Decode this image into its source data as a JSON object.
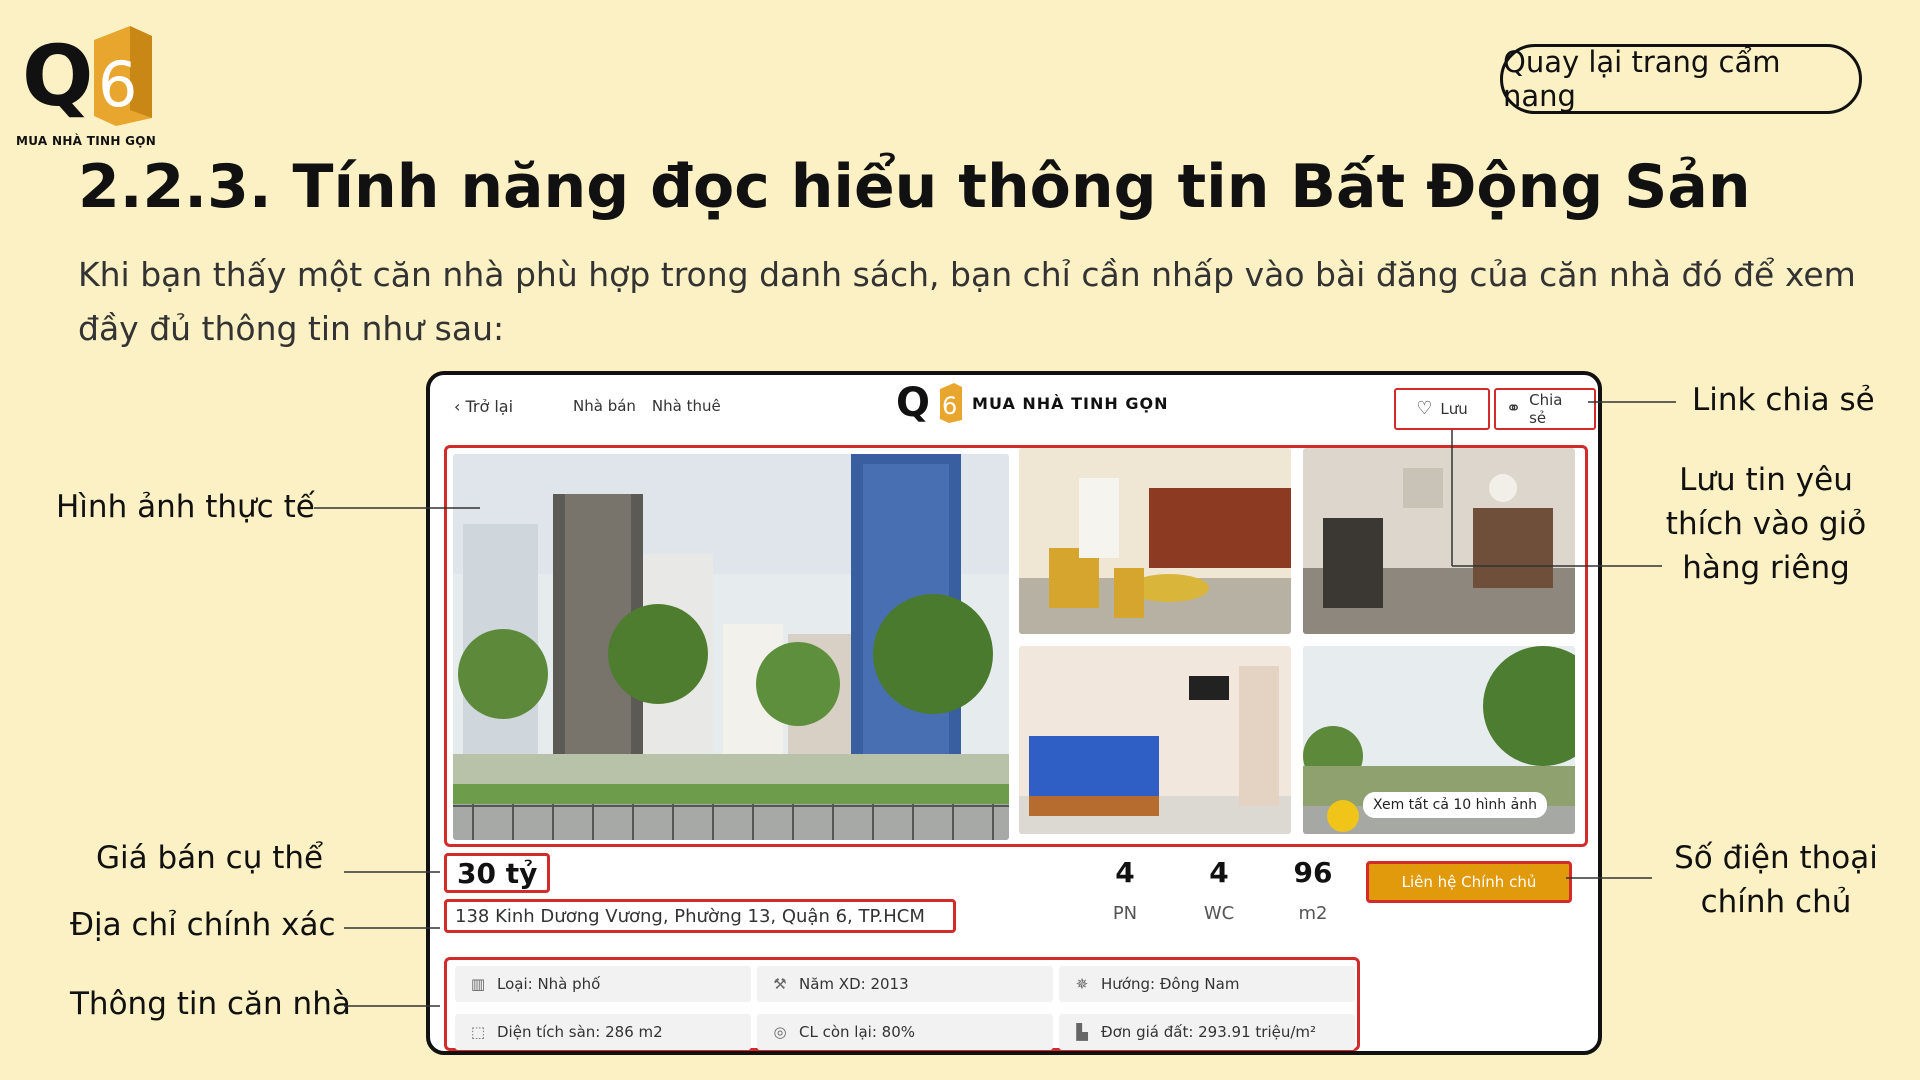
{
  "logo": {
    "letter_q": "Q",
    "digit": "6",
    "tagline": "MUA NHÀ TINH GỌN"
  },
  "header": {
    "back_button": "Quay lại trang cẩm nang"
  },
  "title": "2.2.3. Tính năng đọc hiểu thông tin Bất Động Sản",
  "description": "Khi bạn thấy một căn nhà phù hợp trong danh sách, bạn chỉ cần nhấp vào bài đăng của căn nhà đó để xem đầy đủ thông tin như sau:",
  "mockup": {
    "back": "Trở lại",
    "nav": [
      "Nhà bán",
      "Nhà thuê"
    ],
    "logo_q": "Q",
    "logo_digit": "6",
    "logo_text": "MUA NHÀ TINH GỌN",
    "save": "Lưu",
    "share": "Chia sẻ",
    "see_all": "Xem tất cả 10 hình ảnh",
    "price": "30 tỷ",
    "address": "138 Kinh Dương Vương, Phường 13, Quận 6, TP.HCM",
    "stats": [
      {
        "value": "4",
        "label": "PN"
      },
      {
        "value": "4",
        "label": "WC"
      },
      {
        "value": "96",
        "label": "m2"
      }
    ],
    "contact": "Liên hệ Chính chủ",
    "specs": [
      {
        "icon": "building-icon",
        "text": "Loại: Nhà phố"
      },
      {
        "icon": "hammer-icon",
        "text": "Năm XD: 2013"
      },
      {
        "icon": "compass-icon",
        "text": "Hướng: Đông Nam"
      },
      {
        "icon": "area-icon",
        "text": "Diện tích sàn: 286 m2"
      },
      {
        "icon": "quality-icon",
        "text": "CL còn lại: 80%"
      },
      {
        "icon": "chart-icon",
        "text": "Đơn giá đất: 293.91 triệu/m²"
      }
    ]
  },
  "annotations": {
    "share_link": "Link chia sẻ",
    "photos": "Hình ảnh thực tế",
    "save_fav": "Lưu tin yêu thích vào giỏ hàng riêng",
    "price": "Giá bán cụ thể",
    "phone": "Số điện thoại chính chủ",
    "address": "Địa chỉ chính xác",
    "house_info": "Thông tin căn nhà"
  },
  "colors": {
    "background": "#fbf1c4",
    "highlight": "#d32a2a",
    "accent": "#e09a0c",
    "logo_gold": "#e8a62e"
  }
}
